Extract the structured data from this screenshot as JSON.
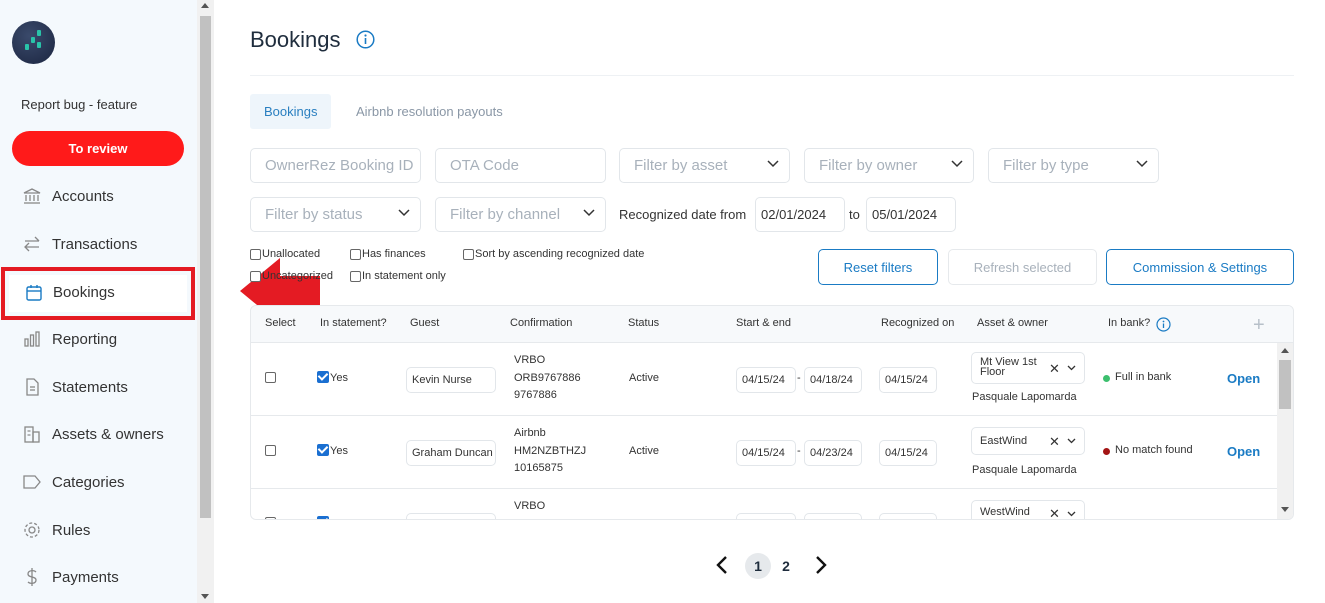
{
  "sidebar": {
    "report_link": "Report bug - feature",
    "review_button": "To review",
    "items": [
      {
        "label": "Accounts",
        "icon": "bank-icon"
      },
      {
        "label": "Transactions",
        "icon": "arrows-exchange-icon"
      },
      {
        "label": "Bookings",
        "icon": "calendar-icon"
      },
      {
        "label": "Reporting",
        "icon": "bar-chart-icon"
      },
      {
        "label": "Statements",
        "icon": "document-icon"
      },
      {
        "label": "Assets & owners",
        "icon": "buildings-icon"
      },
      {
        "label": "Categories",
        "icon": "tag-icon"
      },
      {
        "label": "Rules",
        "icon": "gear-icon"
      },
      {
        "label": "Payments",
        "icon": "dollar-icon"
      }
    ]
  },
  "header": {
    "title": "Bookings"
  },
  "tabs": [
    {
      "label": "Bookings",
      "active": true
    },
    {
      "label": "Airbnb resolution payouts",
      "active": false
    }
  ],
  "filters": {
    "booking_id_placeholder": "OwnerRez Booking ID",
    "ota_code_placeholder": "OTA Code",
    "asset": "Filter by asset",
    "owner": "Filter by owner",
    "type": "Filter by type",
    "status": "Filter by status",
    "channel": "Filter by channel",
    "recognized_label": "Recognized date from",
    "date_from": "02/01/2024",
    "to_label": "to",
    "date_to": "05/01/2024"
  },
  "checkboxes": {
    "unallocated": "Unallocated",
    "uncategorized": "Uncategorized",
    "has_finances": "Has finances",
    "in_statement_only": "In statement only",
    "sort_ascending": "Sort by ascending recognized date"
  },
  "actions": {
    "reset": "Reset filters",
    "refresh": "Refresh selected",
    "commission": "Commission & Settings"
  },
  "table": {
    "columns": [
      "Select",
      "In statement?",
      "Guest",
      "Confirmation",
      "Status",
      "Start & end",
      "Recognized on",
      "Asset & owner",
      "In bank?"
    ],
    "rows": [
      {
        "in_statement": "Yes",
        "guest": "Kevin Nurse",
        "conf_channel": "VRBO",
        "conf_code": "ORB9767886",
        "conf_id": "9767886",
        "status": "Active",
        "start": "04/15/24",
        "end": "04/18/24",
        "recognized": "04/15/24",
        "asset": "Mt View 1st Floor",
        "owner": "Pasquale Lapomarda",
        "bank": "Full in bank",
        "bank_color": "#3cbf6e",
        "open": "Open"
      },
      {
        "in_statement": "Yes",
        "guest": "Graham Duncan",
        "conf_channel": "Airbnb",
        "conf_code": "HM2NZBTHZJ",
        "conf_id": "10165875",
        "status": "Active",
        "start": "04/15/24",
        "end": "04/23/24",
        "recognized": "04/15/24",
        "asset": "EastWind",
        "owner": "Pasquale Lapomarda",
        "bank": "No match found",
        "bank_color": "#a31414",
        "open": "Open"
      },
      {
        "conf_channel": "VRBO",
        "asset": "WestWind"
      }
    ]
  },
  "pagination": {
    "current": "1",
    "next_page": "2"
  },
  "colors": {
    "accent": "#1a7bc4",
    "review": "#ff1a1a",
    "annotation": "#e41b23"
  }
}
